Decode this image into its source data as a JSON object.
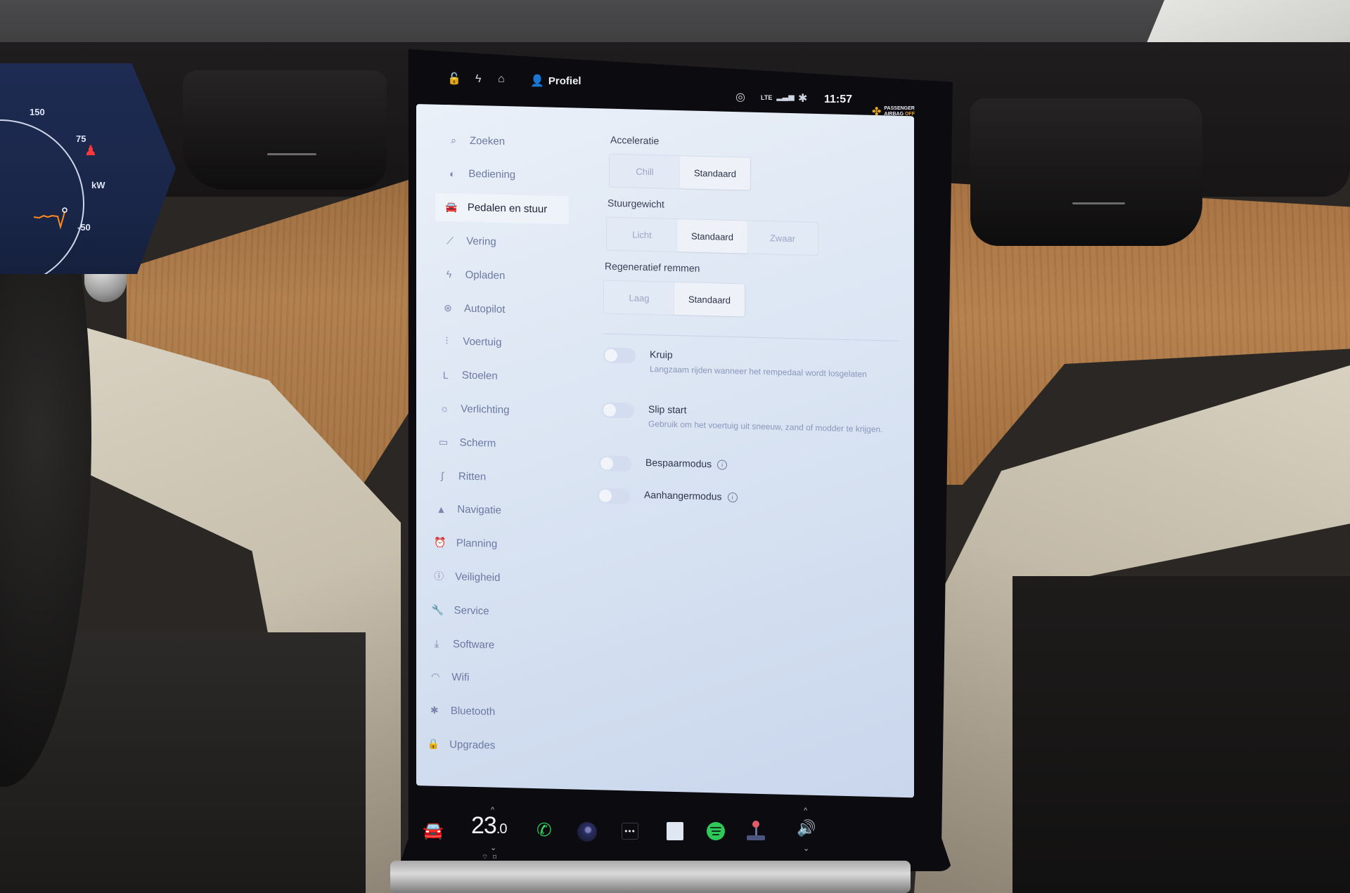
{
  "status_bar": {
    "icons_left": [
      "lock-open-icon",
      "lightning-icon",
      "homelink-icon"
    ],
    "profile_label": "Profiel",
    "network_label": "LTE",
    "time": "11:57",
    "airbag_line1": "PASSENGER",
    "airbag_line2": "AIRBAG",
    "airbag_state": "OFF"
  },
  "cluster": {
    "scale_top": "150",
    "scale_mid": "75",
    "unit": "kW",
    "scale_bottom": "-50"
  },
  "sidebar": {
    "items": [
      {
        "label": "Zoeken",
        "icon": "search-icon",
        "glyph": "⌕"
      },
      {
        "label": "Bediening",
        "icon": "toggle-icon",
        "glyph": "◐"
      },
      {
        "label": "Pedalen en stuur",
        "icon": "car-icon",
        "glyph": "🚘",
        "active": true
      },
      {
        "label": "Vering",
        "icon": "suspension-icon",
        "glyph": "⟋"
      },
      {
        "label": "Opladen",
        "icon": "lightning-icon",
        "glyph": "ϟ"
      },
      {
        "label": "Autopilot",
        "icon": "steering-wheel-icon",
        "glyph": "⊛"
      },
      {
        "label": "Voertuig",
        "icon": "sliders-icon",
        "glyph": "⫶"
      },
      {
        "label": "Stoelen",
        "icon": "seat-icon",
        "glyph": "L"
      },
      {
        "label": "Verlichting",
        "icon": "light-icon",
        "glyph": "☼"
      },
      {
        "label": "Scherm",
        "icon": "display-icon",
        "glyph": "▭"
      },
      {
        "label": "Ritten",
        "icon": "trips-icon",
        "glyph": "∫"
      },
      {
        "label": "Navigatie",
        "icon": "navigation-icon",
        "glyph": "▲"
      },
      {
        "label": "Planning",
        "icon": "alarm-clock-icon",
        "glyph": "⏰"
      },
      {
        "label": "Veiligheid",
        "icon": "alert-circle-icon",
        "glyph": "ⓘ"
      },
      {
        "label": "Service",
        "icon": "wrench-icon",
        "glyph": "🔧"
      },
      {
        "label": "Software",
        "icon": "download-icon",
        "glyph": "⤓"
      },
      {
        "label": "Wifi",
        "icon": "wifi-icon",
        "glyph": "◠"
      },
      {
        "label": "Bluetooth",
        "icon": "bluetooth-icon",
        "glyph": "✱"
      },
      {
        "label": "Upgrades",
        "icon": "bag-icon",
        "glyph": "🔒"
      }
    ]
  },
  "settings": {
    "acceleratie": {
      "label": "Acceleratie",
      "options": [
        "Chill",
        "Standaard"
      ],
      "selected": "Standaard"
    },
    "stuurgewicht": {
      "label": "Stuurgewicht",
      "options": [
        "Licht",
        "Standaard",
        "Zwaar"
      ],
      "selected": "Standaard"
    },
    "regeneratief": {
      "label": "Regeneratief remmen",
      "options": [
        "Laag",
        "Standaard"
      ],
      "selected": "Standaard"
    },
    "toggles": [
      {
        "title": "Kruip",
        "description": "Langzaam rijden wanneer het rempedaal wordt losgelaten",
        "on": false,
        "info": false
      },
      {
        "title": "Slip start",
        "description": "Gebruik om het voertuig uit sneeuw, zand of modder te krijgen.",
        "on": false,
        "info": false
      },
      {
        "title": "Bespaarmodus",
        "description": "",
        "on": false,
        "info": true
      },
      {
        "title": "Aanhangermodus",
        "description": "",
        "on": false,
        "info": true
      }
    ]
  },
  "dock": {
    "temperature_whole": "23",
    "temperature_decimal": ".0",
    "up_chevron": "^",
    "down_chevron": "⌄",
    "defrost_front": "⌔",
    "defrost_rear": "⌑",
    "phone_glyph": "✆",
    "dots": "•••",
    "volume_glyph": "🔊",
    "car_glyph": "🚘"
  }
}
